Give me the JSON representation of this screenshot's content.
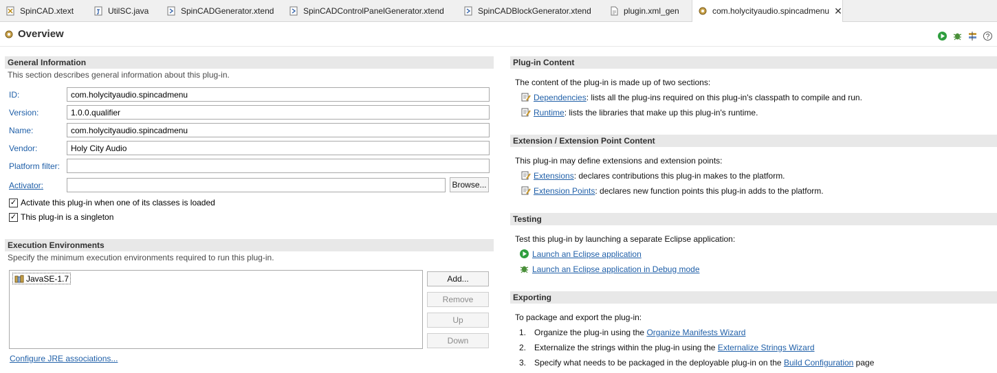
{
  "tabs": [
    {
      "label": "SpinCAD.xtext",
      "icon": "xtext-file-icon"
    },
    {
      "label": "UtilSC.java",
      "icon": "java-file-icon"
    },
    {
      "label": "SpinCADGenerator.xtend",
      "icon": "xtend-file-icon"
    },
    {
      "label": "SpinCADControlPanelGenerator.xtend",
      "icon": "xtend-file-icon"
    },
    {
      "label": "SpinCADBlockGenerator.xtend",
      "icon": "xtend-file-icon"
    },
    {
      "label": "plugin.xml_gen",
      "icon": "file-icon"
    },
    {
      "label": "com.holycityaudio.spincadmenu",
      "icon": "plugin-manifest-icon",
      "active": true
    }
  ],
  "header": {
    "title": "Overview"
  },
  "general": {
    "title": "General Information",
    "desc": "This section describes general information about this plug-in.",
    "id_label": "ID:",
    "id_value": "com.holycityaudio.spincadmenu",
    "version_label": "Version:",
    "version_value": "1.0.0.qualifier",
    "name_label": "Name:",
    "name_value": "com.holycityaudio.spincadmenu",
    "vendor_label": "Vendor:",
    "vendor_value": "Holy City Audio",
    "platform_label": "Platform filter:",
    "platform_value": "",
    "activator_label": "Activator:",
    "activator_value": "",
    "browse": "Browse...",
    "chk1": "Activate this plug-in when one of its classes is loaded",
    "chk2": "This plug-in is a singleton"
  },
  "exec": {
    "title": "Execution Environments",
    "desc": "Specify the minimum execution environments required to run this plug-in.",
    "item": "JavaSE-1.7",
    "add": "Add...",
    "remove": "Remove",
    "up": "Up",
    "down": "Down",
    "config": "Configure JRE associations..."
  },
  "content": {
    "title": "Plug-in Content",
    "desc": "The content of the plug-in is made up of two sections:",
    "deps_link": "Dependencies",
    "deps_text": ": lists all the plug-ins required on this plug-in's classpath to compile and run.",
    "runtime_link": "Runtime",
    "runtime_text": ": lists the libraries that make up this plug-in's runtime."
  },
  "extension": {
    "title": "Extension / Extension Point Content",
    "desc": "This plug-in may define extensions and extension points:",
    "ext_link": "Extensions",
    "ext_text": ": declares contributions this plug-in makes to the platform.",
    "pts_link": "Extension Points",
    "pts_text": ": declares new function points this plug-in adds to the platform."
  },
  "testing": {
    "title": "Testing",
    "desc": "Test this plug-in by launching a separate Eclipse application:",
    "launch": "Launch an Eclipse application",
    "debug": "Launch an Eclipse application in Debug mode"
  },
  "exporting": {
    "title": "Exporting",
    "desc": "To package and export the plug-in:",
    "s1_num": "1.",
    "s1_text": "Organize the plug-in using the ",
    "s1_link": "Organize Manifests Wizard",
    "s2_num": "2.",
    "s2_text": "Externalize the strings within the plug-in using the ",
    "s2_link": "Externalize Strings Wizard",
    "s3_num": "3.",
    "s3_text": "Specify what needs to be packaged in the deployable plug-in on the ",
    "s3_link": "Build Configuration",
    "s3_tail": " page"
  }
}
